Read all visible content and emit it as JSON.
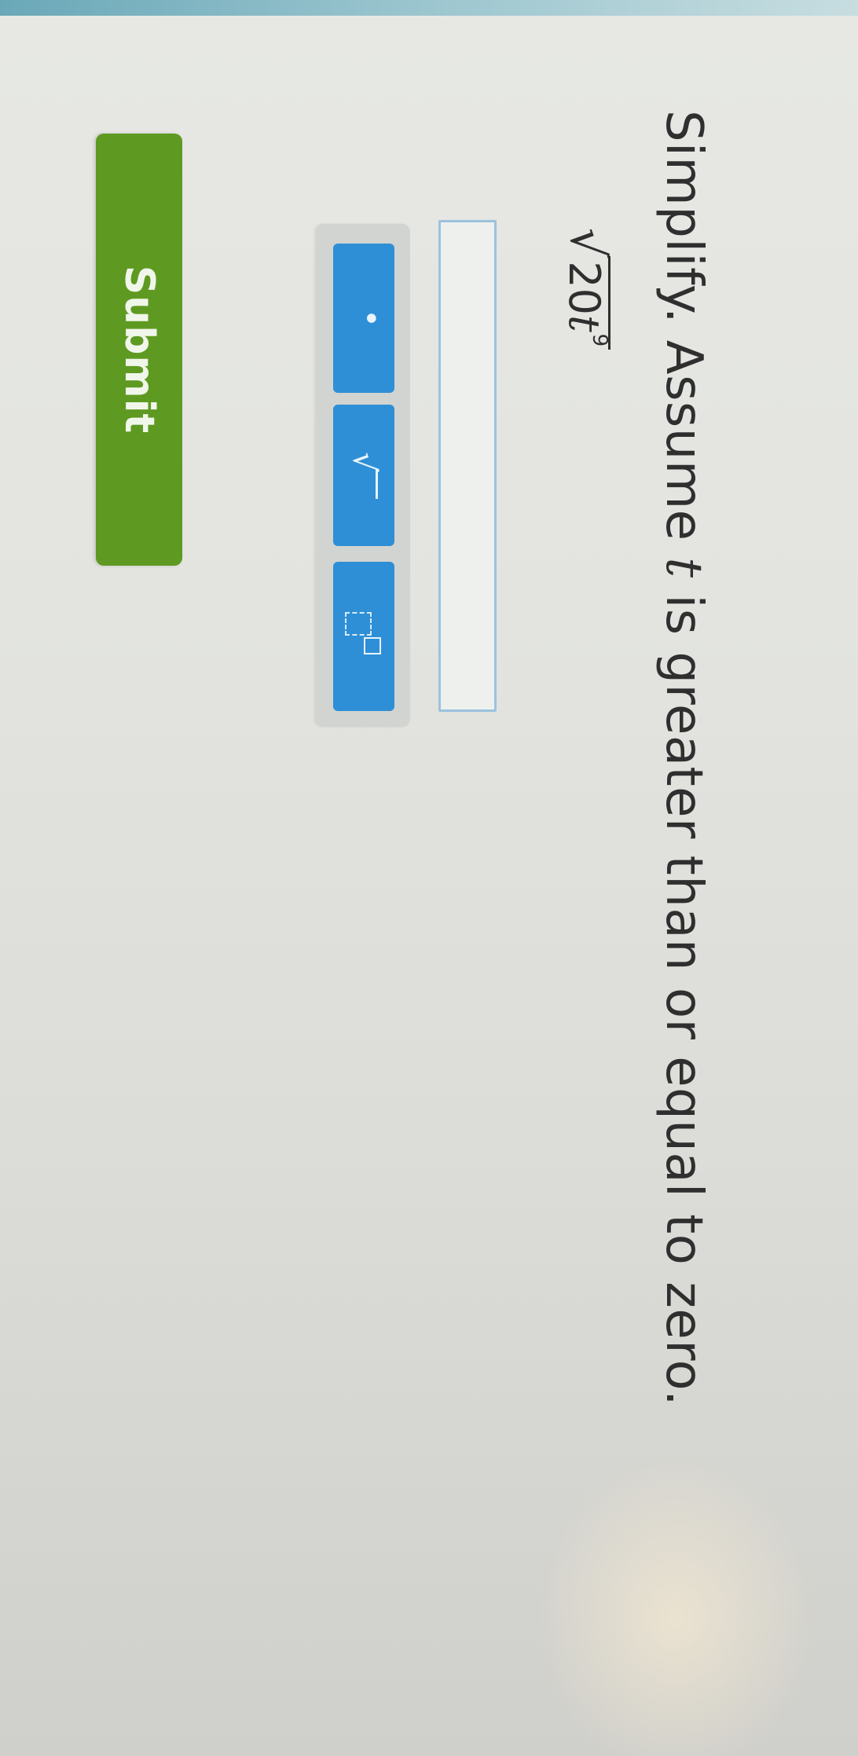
{
  "question": {
    "prefix": "Simplify. Assume ",
    "variable": "t",
    "suffix": " is greater than or equal to zero."
  },
  "expression": {
    "coefficient": "20",
    "variable": "t",
    "exponent": "9"
  },
  "answer": {
    "value": ""
  },
  "toolbar": {
    "buttons": [
      {
        "icon": "dot-icon",
        "symbol": "•"
      },
      {
        "icon": "sqrt-icon",
        "symbol": "√"
      },
      {
        "icon": "exponent-icon"
      }
    ],
    "button_color": "#2e8fd6"
  },
  "submit": {
    "label": "Submit",
    "color": "#5e9a22"
  }
}
